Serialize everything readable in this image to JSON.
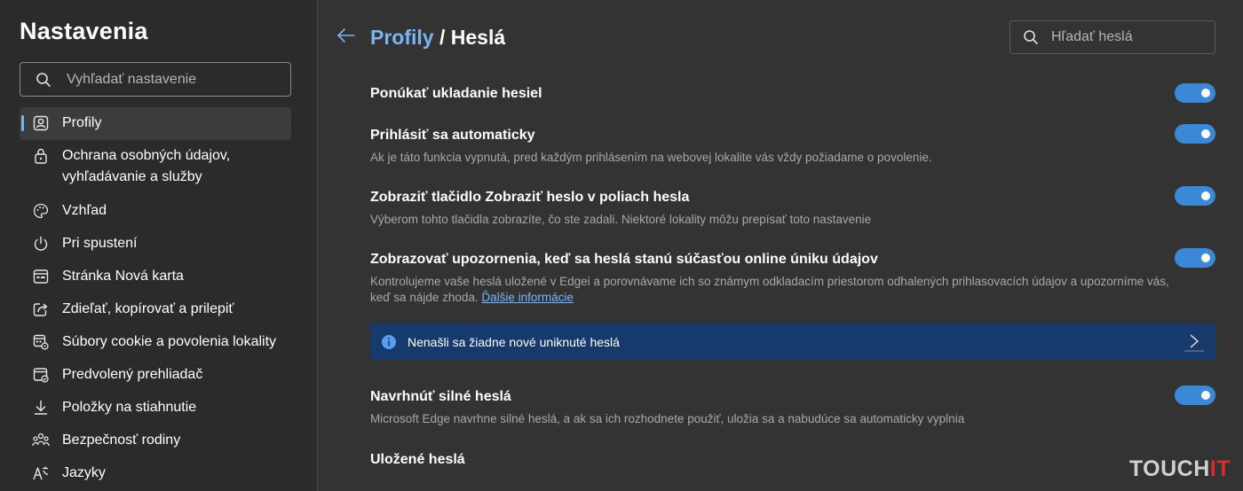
{
  "sidebar": {
    "title": "Nastavenia",
    "search_placeholder": "Vyhľadať nastavenie",
    "items": [
      {
        "label": "Profily",
        "icon": "profile-icon"
      },
      {
        "label": "Ochrana osobných údajov,\nvyhľadávanie a služby",
        "icon": "lock-icon"
      },
      {
        "label": "Vzhľad",
        "icon": "palette-icon"
      },
      {
        "label": "Pri spustení",
        "icon": "power-icon"
      },
      {
        "label": "Stránka Nová karta",
        "icon": "new-tab-icon"
      },
      {
        "label": "Zdieľať, kopírovať a prilepiť",
        "icon": "share-icon"
      },
      {
        "label": "Súbory cookie a povolenia lokality",
        "icon": "cookie-icon"
      },
      {
        "label": "Predvolený prehliadač",
        "icon": "browser-icon"
      },
      {
        "label": "Položky na stiahnutie",
        "icon": "download-icon"
      },
      {
        "label": "Bezpečnosť rodiny",
        "icon": "family-icon"
      },
      {
        "label": "Jazyky",
        "icon": "language-icon"
      }
    ]
  },
  "header": {
    "breadcrumb_link": "Profily",
    "breadcrumb_sep": " / ",
    "breadcrumb_current": "Heslá",
    "search_placeholder": "Hľadať heslá"
  },
  "settings": {
    "offer_save": {
      "title": "Ponúkať ukladanie hesiel",
      "on": true
    },
    "auto_signin": {
      "title": "Prihlásiť sa automaticky",
      "desc": "Ak je táto funkcia vypnutá, pred každým prihlásením na webovej lokalite vás vždy požiadame o povolenie.",
      "on": true
    },
    "reveal_button": {
      "title": "Zobraziť tlačidlo Zobraziť heslo v poliach hesla",
      "desc": "Výberom tohto tlačidla zobrazíte, čo ste zadali. Niektoré lokality môžu prepísať toto nastavenie",
      "on": true
    },
    "leak_alerts": {
      "title": "Zobrazovať upozornenia, keď sa heslá stanú súčasťou online úniku údajov",
      "desc": "Kontrolujeme vaše heslá uložené v Edgei a porovnávame ich so známym odkladacím priestorom odhalených prihlasovacích údajov a upozorníme vás, keď sa nájde zhoda.",
      "more_link": "Ďalšie informácie",
      "on": true
    },
    "suggest_strong": {
      "title": "Navrhnúť silné heslá",
      "desc": "Microsoft Edge navrhne silné heslá, a ak sa ich rozhodnete použiť, uložia sa a nabudúce sa automaticky vyplnia",
      "on": true
    },
    "saved_title": "Uložené heslá"
  },
  "alert": {
    "text": "Nenašli sa žiadne nové uniknuté heslá"
  },
  "watermark": {
    "main": "TOUCH",
    "accent": "IT"
  },
  "colors": {
    "accent": "#7ab4f5",
    "toggle_on": "#3b88d6",
    "alert_bg": "#153a6b",
    "sidebar_bg": "#2b2b2b",
    "main_bg": "#333333"
  }
}
